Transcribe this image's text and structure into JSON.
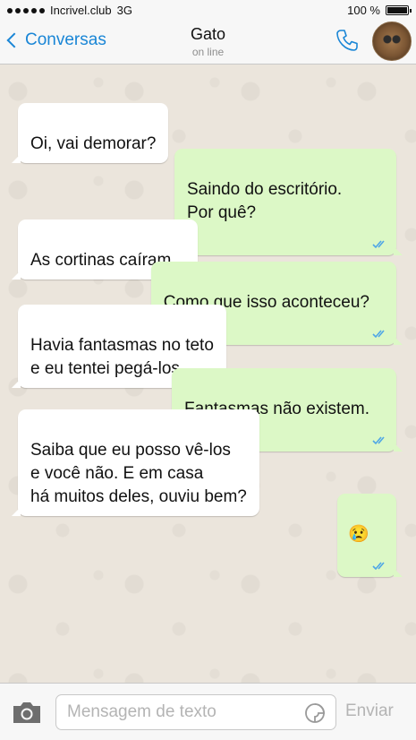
{
  "status_bar": {
    "carrier": "Incrivel.club",
    "network": "3G",
    "battery": "100 %"
  },
  "header": {
    "back_label": "Conversas",
    "contact_name": "Gato",
    "contact_status": "on line",
    "icons": {
      "back": "chevron-left-icon",
      "call": "phone-icon",
      "avatar": "cat-avatar"
    }
  },
  "messages": [
    {
      "direction": "in",
      "text": "Oi, vai demorar?"
    },
    {
      "direction": "out",
      "text": "Saindo do escritório.\nPor quê?",
      "read": true
    },
    {
      "direction": "in",
      "text": "As cortinas caíram..."
    },
    {
      "direction": "out",
      "text": "Como que isso aconteceu?",
      "read": true
    },
    {
      "direction": "in",
      "text": "Havia fantasmas no teto\ne eu tentei pegá-los."
    },
    {
      "direction": "out",
      "text": "Fantasmas não existem.",
      "read": true
    },
    {
      "direction": "in",
      "text": "Saiba que eu posso vê-los\ne você não. E em casa\nhá muitos deles, ouviu bem?"
    },
    {
      "direction": "out",
      "text": "😢",
      "read": true
    }
  ],
  "input_bar": {
    "placeholder": "Mensagem de texto",
    "value": "",
    "send_label": "Enviar",
    "icons": {
      "camera": "camera-icon",
      "sticker": "sticker-icon"
    }
  },
  "colors": {
    "accent": "#1a86d6",
    "outgoing_bubble": "#dcf8c6",
    "incoming_bubble": "#ffffff",
    "chat_background": "#ebe5dc",
    "read_ticks": "#4fa6e6"
  }
}
